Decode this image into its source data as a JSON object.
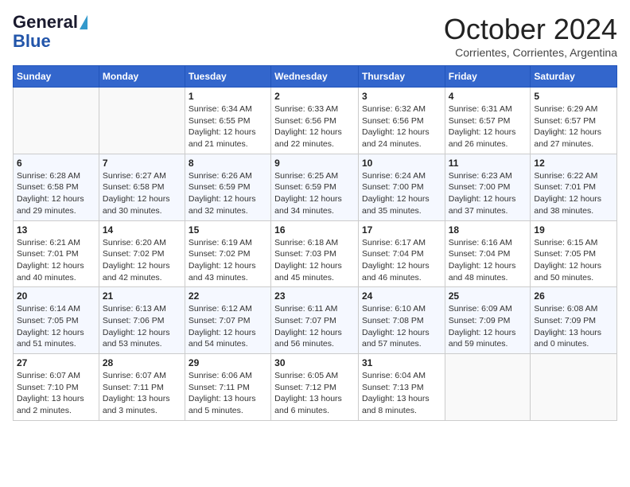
{
  "header": {
    "logo_general": "General",
    "logo_blue": "Blue",
    "month_title": "October 2024",
    "location": "Corrientes, Corrientes, Argentina"
  },
  "days_of_week": [
    "Sunday",
    "Monday",
    "Tuesday",
    "Wednesday",
    "Thursday",
    "Friday",
    "Saturday"
  ],
  "weeks": [
    [
      {
        "day": "",
        "info": ""
      },
      {
        "day": "",
        "info": ""
      },
      {
        "day": "1",
        "info": "Sunrise: 6:34 AM\nSunset: 6:55 PM\nDaylight: 12 hours and 21 minutes."
      },
      {
        "day": "2",
        "info": "Sunrise: 6:33 AM\nSunset: 6:56 PM\nDaylight: 12 hours and 22 minutes."
      },
      {
        "day": "3",
        "info": "Sunrise: 6:32 AM\nSunset: 6:56 PM\nDaylight: 12 hours and 24 minutes."
      },
      {
        "day": "4",
        "info": "Sunrise: 6:31 AM\nSunset: 6:57 PM\nDaylight: 12 hours and 26 minutes."
      },
      {
        "day": "5",
        "info": "Sunrise: 6:29 AM\nSunset: 6:57 PM\nDaylight: 12 hours and 27 minutes."
      }
    ],
    [
      {
        "day": "6",
        "info": "Sunrise: 6:28 AM\nSunset: 6:58 PM\nDaylight: 12 hours and 29 minutes."
      },
      {
        "day": "7",
        "info": "Sunrise: 6:27 AM\nSunset: 6:58 PM\nDaylight: 12 hours and 30 minutes."
      },
      {
        "day": "8",
        "info": "Sunrise: 6:26 AM\nSunset: 6:59 PM\nDaylight: 12 hours and 32 minutes."
      },
      {
        "day": "9",
        "info": "Sunrise: 6:25 AM\nSunset: 6:59 PM\nDaylight: 12 hours and 34 minutes."
      },
      {
        "day": "10",
        "info": "Sunrise: 6:24 AM\nSunset: 7:00 PM\nDaylight: 12 hours and 35 minutes."
      },
      {
        "day": "11",
        "info": "Sunrise: 6:23 AM\nSunset: 7:00 PM\nDaylight: 12 hours and 37 minutes."
      },
      {
        "day": "12",
        "info": "Sunrise: 6:22 AM\nSunset: 7:01 PM\nDaylight: 12 hours and 38 minutes."
      }
    ],
    [
      {
        "day": "13",
        "info": "Sunrise: 6:21 AM\nSunset: 7:01 PM\nDaylight: 12 hours and 40 minutes."
      },
      {
        "day": "14",
        "info": "Sunrise: 6:20 AM\nSunset: 7:02 PM\nDaylight: 12 hours and 42 minutes."
      },
      {
        "day": "15",
        "info": "Sunrise: 6:19 AM\nSunset: 7:02 PM\nDaylight: 12 hours and 43 minutes."
      },
      {
        "day": "16",
        "info": "Sunrise: 6:18 AM\nSunset: 7:03 PM\nDaylight: 12 hours and 45 minutes."
      },
      {
        "day": "17",
        "info": "Sunrise: 6:17 AM\nSunset: 7:04 PM\nDaylight: 12 hours and 46 minutes."
      },
      {
        "day": "18",
        "info": "Sunrise: 6:16 AM\nSunset: 7:04 PM\nDaylight: 12 hours and 48 minutes."
      },
      {
        "day": "19",
        "info": "Sunrise: 6:15 AM\nSunset: 7:05 PM\nDaylight: 12 hours and 50 minutes."
      }
    ],
    [
      {
        "day": "20",
        "info": "Sunrise: 6:14 AM\nSunset: 7:05 PM\nDaylight: 12 hours and 51 minutes."
      },
      {
        "day": "21",
        "info": "Sunrise: 6:13 AM\nSunset: 7:06 PM\nDaylight: 12 hours and 53 minutes."
      },
      {
        "day": "22",
        "info": "Sunrise: 6:12 AM\nSunset: 7:07 PM\nDaylight: 12 hours and 54 minutes."
      },
      {
        "day": "23",
        "info": "Sunrise: 6:11 AM\nSunset: 7:07 PM\nDaylight: 12 hours and 56 minutes."
      },
      {
        "day": "24",
        "info": "Sunrise: 6:10 AM\nSunset: 7:08 PM\nDaylight: 12 hours and 57 minutes."
      },
      {
        "day": "25",
        "info": "Sunrise: 6:09 AM\nSunset: 7:09 PM\nDaylight: 12 hours and 59 minutes."
      },
      {
        "day": "26",
        "info": "Sunrise: 6:08 AM\nSunset: 7:09 PM\nDaylight: 13 hours and 0 minutes."
      }
    ],
    [
      {
        "day": "27",
        "info": "Sunrise: 6:07 AM\nSunset: 7:10 PM\nDaylight: 13 hours and 2 minutes."
      },
      {
        "day": "28",
        "info": "Sunrise: 6:07 AM\nSunset: 7:11 PM\nDaylight: 13 hours and 3 minutes."
      },
      {
        "day": "29",
        "info": "Sunrise: 6:06 AM\nSunset: 7:11 PM\nDaylight: 13 hours and 5 minutes."
      },
      {
        "day": "30",
        "info": "Sunrise: 6:05 AM\nSunset: 7:12 PM\nDaylight: 13 hours and 6 minutes."
      },
      {
        "day": "31",
        "info": "Sunrise: 6:04 AM\nSunset: 7:13 PM\nDaylight: 13 hours and 8 minutes."
      },
      {
        "day": "",
        "info": ""
      },
      {
        "day": "",
        "info": ""
      }
    ]
  ]
}
